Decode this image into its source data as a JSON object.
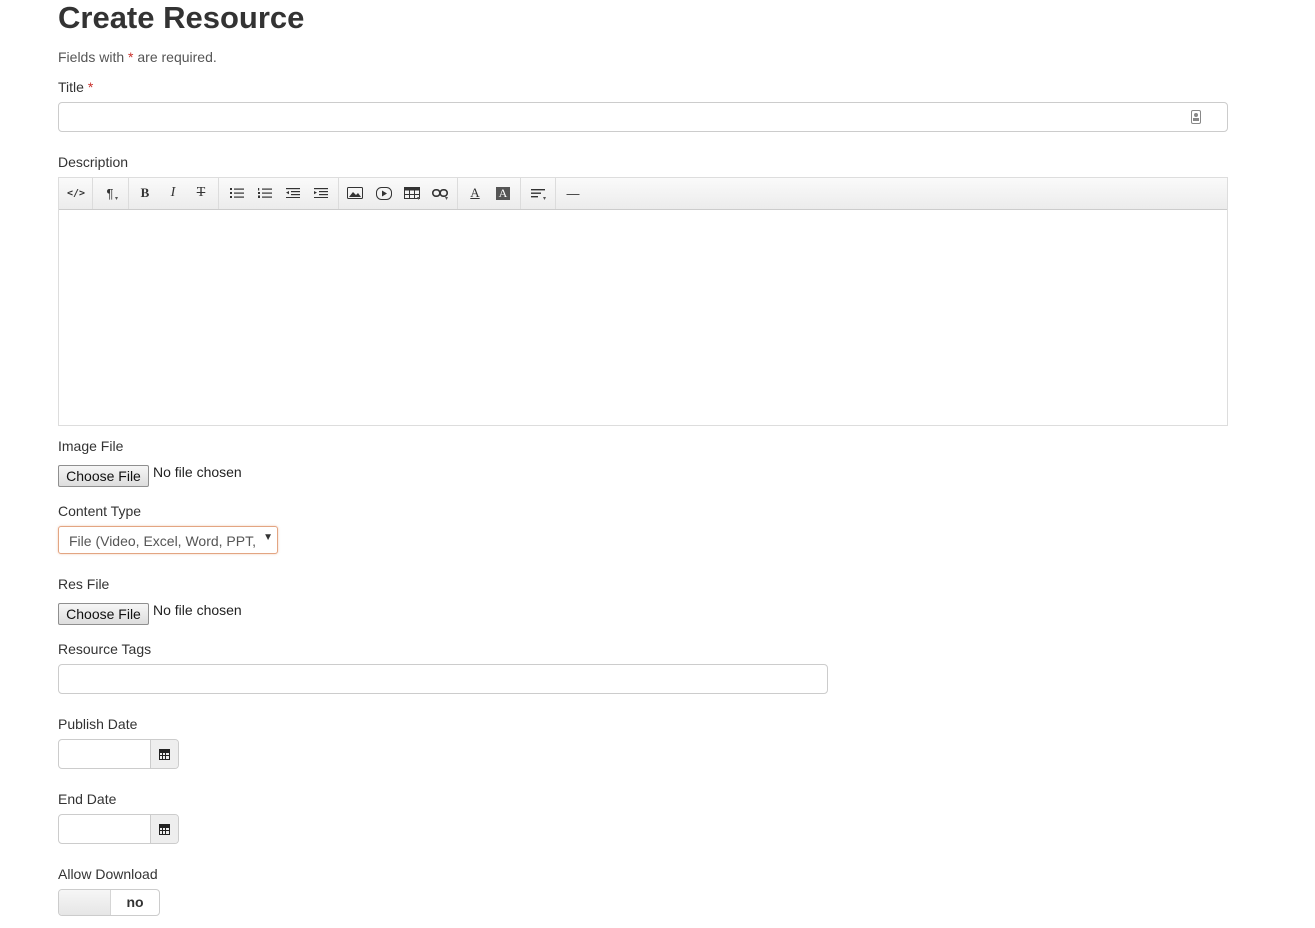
{
  "page": {
    "title": "Create Resource",
    "required_hint_prefix": "Fields with",
    "required_marker": "*",
    "required_hint_suffix": "are required."
  },
  "form": {
    "title": {
      "label": "Title",
      "required": "*",
      "value": ""
    },
    "description": {
      "label": "Description",
      "toolbar": [
        {
          "name": "code-view",
          "glyph": "</>"
        },
        {
          "name": "paragraph-style",
          "glyph": "¶"
        },
        {
          "name": "bold",
          "glyph": "B"
        },
        {
          "name": "italic",
          "glyph": "I"
        },
        {
          "name": "strikethrough",
          "glyph": "T"
        },
        {
          "name": "unordered-list",
          "glyph": ""
        },
        {
          "name": "ordered-list",
          "glyph": ""
        },
        {
          "name": "outdent",
          "glyph": ""
        },
        {
          "name": "indent",
          "glyph": ""
        },
        {
          "name": "image",
          "glyph": ""
        },
        {
          "name": "video",
          "glyph": ""
        },
        {
          "name": "table",
          "glyph": ""
        },
        {
          "name": "link",
          "glyph": ""
        },
        {
          "name": "font-color",
          "glyph": "A"
        },
        {
          "name": "background-color",
          "glyph": "A"
        },
        {
          "name": "align",
          "glyph": ""
        },
        {
          "name": "horizontal-rule",
          "glyph": "—"
        }
      ]
    },
    "image_file": {
      "label": "Image File",
      "button": "Choose File",
      "status": "No file chosen"
    },
    "content_type": {
      "label": "Content Type",
      "selected": "File (Video, Excel, Word, PPT, Audio)"
    },
    "res_file": {
      "label": "Res File",
      "button": "Choose File",
      "status": "No file chosen"
    },
    "resource_tags": {
      "label": "Resource Tags",
      "value": ""
    },
    "publish_date": {
      "label": "Publish Date",
      "value": ""
    },
    "end_date": {
      "label": "End Date",
      "value": ""
    },
    "allow_download": {
      "label": "Allow Download",
      "state": "no"
    }
  },
  "colors": {
    "required": "#c9302c",
    "select_focus_border": "#e3a582",
    "text": "#333333"
  }
}
